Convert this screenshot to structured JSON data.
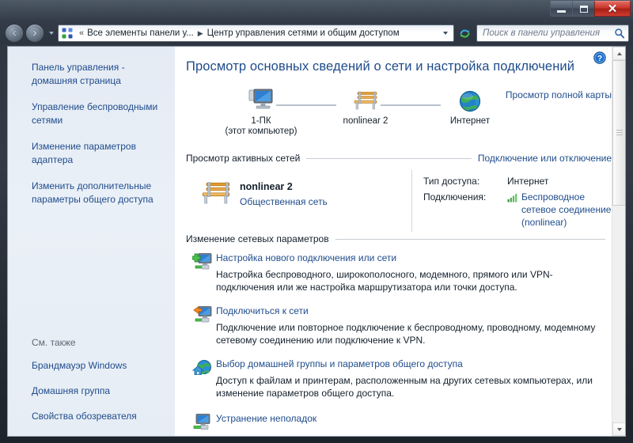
{
  "window": {
    "buttons": {
      "minimize": "minimize",
      "maximize": "maximize",
      "close": "close"
    }
  },
  "navbar": {
    "back": "Назад",
    "forward": "Вперёд",
    "recent_pages": "Последние страницы",
    "breadcrumb": {
      "overflow": "«",
      "items": [
        "Все элементы панели у...",
        "Центр управления сетями и общим доступом"
      ],
      "separator": "▶"
    },
    "refresh": "Обновить",
    "search": {
      "placeholder": "Поиск в панели управления",
      "value": ""
    }
  },
  "sidebar": {
    "top_items": [
      "Панель управления - домашняя страница",
      "Управление беспроводными сетями",
      "Изменение параметров адаптера",
      "Изменить дополнительные параметры общего доступа"
    ],
    "see_also_label": "См. также",
    "bottom_items": [
      "Брандмауэр Windows",
      "Домашняя группа",
      "Свойства обозревателя"
    ]
  },
  "content": {
    "page_title": "Просмотр основных сведений о сети и настройка подключений",
    "help_tooltip": "Справка",
    "map": {
      "nodes": [
        {
          "icon": "computer-icon",
          "label": "1-ПК",
          "sub": "(этот компьютер)"
        },
        {
          "icon": "bench-icon",
          "label": "nonlinear  2",
          "sub": ""
        },
        {
          "icon": "globe-icon",
          "label": "Интернет",
          "sub": ""
        }
      ],
      "full_map_link": "Просмотр полной карты"
    },
    "active_networks": {
      "heading": "Просмотр активных сетей",
      "action_link": "Подключение или отключение",
      "network": {
        "icon": "bench-icon",
        "name": "nonlinear  2",
        "type_link": "Общественная сеть"
      },
      "details": [
        {
          "key": "Тип доступа:",
          "value": "Интернет",
          "link": false
        },
        {
          "key": "Подключения:",
          "value": "Беспроводное сетевое соединение (nonlinear)",
          "link": true,
          "icon": "wifi-signal-icon"
        }
      ]
    },
    "change_settings": {
      "heading": "Изменение сетевых параметров",
      "options": [
        {
          "icon": "new-connection-icon",
          "title": "Настройка нового подключения или сети",
          "desc": "Настройка беспроводного, широкополосного, модемного, прямого или VPN-подключения или же настройка маршрутизатора или точки доступа."
        },
        {
          "icon": "connect-network-icon",
          "title": "Подключиться к сети",
          "desc": "Подключение или повторное подключение к беспроводному, проводному, модемному сетевому соединению или подключение к VPN."
        },
        {
          "icon": "homegroup-icon",
          "title": "Выбор домашней группы и параметров общего доступа",
          "desc": "Доступ к файлам и принтерам, расположенным на других сетевых компьютерах, или изменение параметров общего доступа."
        },
        {
          "icon": "troubleshoot-icon",
          "title": "Устранение неполадок",
          "desc": ""
        }
      ]
    }
  },
  "scrollbar": {
    "up": "Вверх",
    "down": "Вниз",
    "thumb": "Полоса прокрутки"
  },
  "colors": {
    "link": "#1f4c8c",
    "text": "#14202c",
    "sidebar_bg": "#e8eef6",
    "close_button": "#c8342a"
  }
}
